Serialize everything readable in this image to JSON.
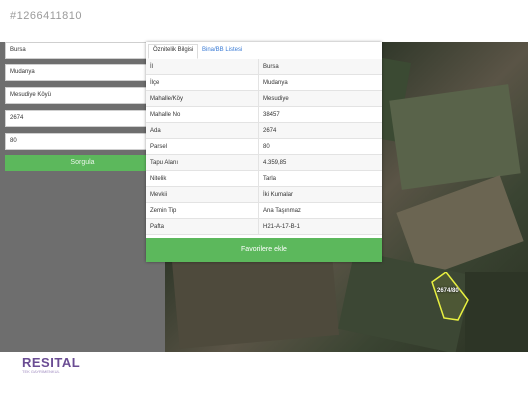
{
  "listing_id": "#1266411810",
  "search_form": {
    "province": "Bursa",
    "district": "Mudanya",
    "neighborhood": "Mesudiye Köyü",
    "block": "2674",
    "parcel": "80",
    "query_button": "Sorgula"
  },
  "popup": {
    "tabs": [
      {
        "label": "Öznitelik Bilgisi",
        "active": true
      },
      {
        "label": "Bina/BB Listesi",
        "active": false
      }
    ],
    "rows": [
      {
        "key": "İl",
        "value": "Bursa"
      },
      {
        "key": "İlçe",
        "value": "Mudanya"
      },
      {
        "key": "Mahalle/Köy",
        "value": "Mesudiye"
      },
      {
        "key": "Mahalle No",
        "value": "38457"
      },
      {
        "key": "Ada",
        "value": "2674"
      },
      {
        "key": "Parsel",
        "value": "80"
      },
      {
        "key": "Tapu Alanı",
        "value": "4.359,85"
      },
      {
        "key": "Nitelik",
        "value": "Tarla"
      },
      {
        "key": "Mevkii",
        "value": "İki Kumalar"
      },
      {
        "key": "Zemin Tip",
        "value": "Ana Taşınmaz"
      },
      {
        "key": "Pafta",
        "value": "H21-A-17-B-1"
      }
    ],
    "favorite_button": "Favorilere ekle"
  },
  "map": {
    "parcel_label": "2674/80"
  },
  "logo": {
    "main": "RESITAL",
    "sub": "TEK GAYRİMENKUL"
  },
  "colors": {
    "accent_green": "#5cb85c",
    "parcel_outline": "#e8f040",
    "logo_purple": "#6a4c93"
  }
}
